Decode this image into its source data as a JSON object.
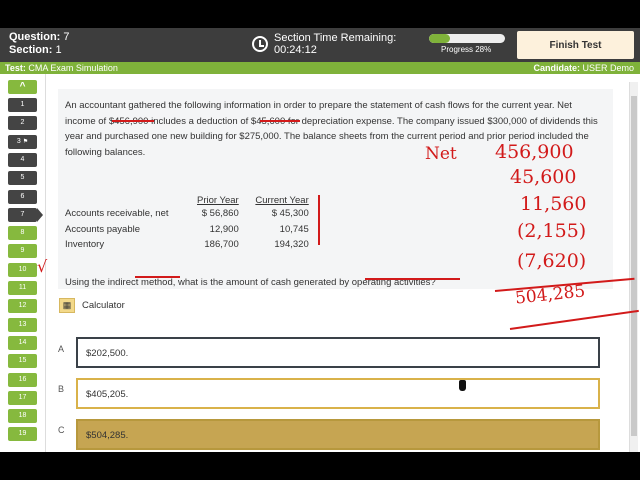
{
  "header": {
    "question_label": "Question:",
    "question_value": "7",
    "section_label": "Section:",
    "section_value": "1",
    "timer_label": "Section Time Remaining:",
    "timer_value": "00:24:12",
    "progress_label": "Progress 28%",
    "progress_percent": 28,
    "finish_label": "Finish Test"
  },
  "subheader": {
    "test_label": "Test:",
    "test_value": "CMA Exam Simulation",
    "candidate_label": "Candidate:",
    "candidate_value": "USER Demo"
  },
  "nav": {
    "up": "^",
    "items": [
      "1",
      "2",
      "3",
      "4",
      "5",
      "6",
      "7",
      "8",
      "9",
      "10",
      "11",
      "12",
      "13",
      "14",
      "15",
      "16",
      "17",
      "18",
      "19"
    ],
    "current": "7",
    "flagged": "3"
  },
  "question": {
    "stem": "An accountant gathered the following information in order to prepare the statement of cash flows for the current year. Net income of $456,900 includes a deduction of $45,600 for depreciation expense. The company issued $300,000 of dividends this year and purchased one new building for $275,000. The balance sheets from the current period and prior period included the following balances.",
    "table": {
      "headers": [
        "",
        "Prior Year",
        "Current Year"
      ],
      "rows": [
        [
          "Accounts receivable, net",
          "$ 56,860",
          "$ 45,300"
        ],
        [
          "Accounts payable",
          "12,900",
          "10,745"
        ],
        [
          "Inventory",
          "186,700",
          "194,320"
        ]
      ]
    },
    "ask": "Using the indirect method, what is the amount of cash generated by operating activities?"
  },
  "calculator_label": "Calculator",
  "options": [
    {
      "letter": "A",
      "text": "$202,500."
    },
    {
      "letter": "B",
      "text": "$405,205."
    },
    {
      "letter": "C",
      "text": "$504,285."
    }
  ],
  "annotations": {
    "net": "Net",
    "l1": "456,900",
    "l2": "45,600",
    "l3": "11,560",
    "l4": "(2,155)",
    "l5": "(7,620)",
    "total": "504,285",
    "check": "√"
  }
}
